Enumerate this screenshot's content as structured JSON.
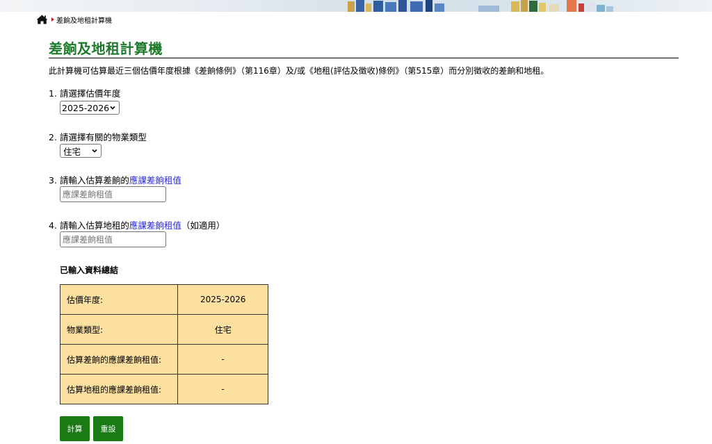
{
  "breadcrumb": {
    "current": "差餉及地租計算機"
  },
  "page": {
    "title": "差餉及地租計算機",
    "description": "此計算機可估算最近三個估價年度根據《差餉條例》（第116章）及/或《地租(評估及徵收)條例》（第515章）而分別徵收的差餉和地租。"
  },
  "q1": {
    "label": "1. 請選擇估價年度",
    "selected": "2025-2026"
  },
  "q2": {
    "label": "2. 請選擇有關的物業類型",
    "selected": "住宅"
  },
  "q3": {
    "prefix": "3. 請輸入估算差餉的",
    "link": "應課差餉租值",
    "placeholder": "應課差餉租值"
  },
  "q4": {
    "prefix": "4. 請輸入估算地租的",
    "link": "應課差餉租值",
    "suffix": "（如適用）",
    "placeholder": "應課差餉租值"
  },
  "summary": {
    "title": "已輸入資料總結",
    "rows": [
      {
        "key": "估價年度:",
        "value": "2025-2026"
      },
      {
        "key": "物業類型:",
        "value": "住宅"
      },
      {
        "key": "估算差餉的應課差餉租值:",
        "value": "-"
      },
      {
        "key": "估算地租的應課差餉租值:",
        "value": "-"
      }
    ]
  },
  "buttons": {
    "calculate": "計算",
    "reset": "重設"
  },
  "colors": {
    "title": "#1c7a2a",
    "link": "#2b2bd9",
    "table_bg": "#fbe0a0",
    "button": "#1a7a14"
  }
}
